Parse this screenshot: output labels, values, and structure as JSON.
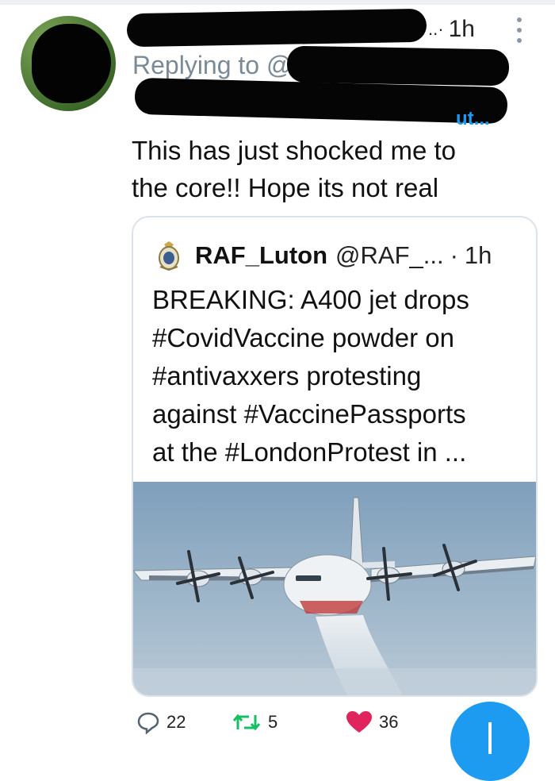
{
  "tweet": {
    "time": "1h",
    "truncation_tail": "..·",
    "replying_prefix": "Replying to @",
    "handle_tail": "ut...",
    "text_line1": "This has just shocked me to",
    "text_line2": "the core!! Hope its not real"
  },
  "quoted_tweet": {
    "name": "RAF_Luton",
    "handle": "@RAF_...",
    "time_sep": "·",
    "time": "1h",
    "lines": [
      "BREAKING: A400 jet drops",
      "#CovidVaccine powder on",
      "#antivaxxers protesting",
      "against #VaccinePassports",
      "at the #LondonProtest in ..."
    ],
    "image_subject": "cargo plane dropping powder"
  },
  "actions": {
    "replies": "22",
    "retweets": "5",
    "likes": "36"
  },
  "colors": {
    "accent": "#1d9bf0",
    "like": "#e0245e",
    "retweet": "#17bf63",
    "muted": "#7b8a96"
  },
  "icons": {
    "reply": "reply-icon",
    "retweet": "retweet-icon",
    "like": "heart-icon",
    "menu": "more-icon",
    "compose": "compose-icon"
  }
}
